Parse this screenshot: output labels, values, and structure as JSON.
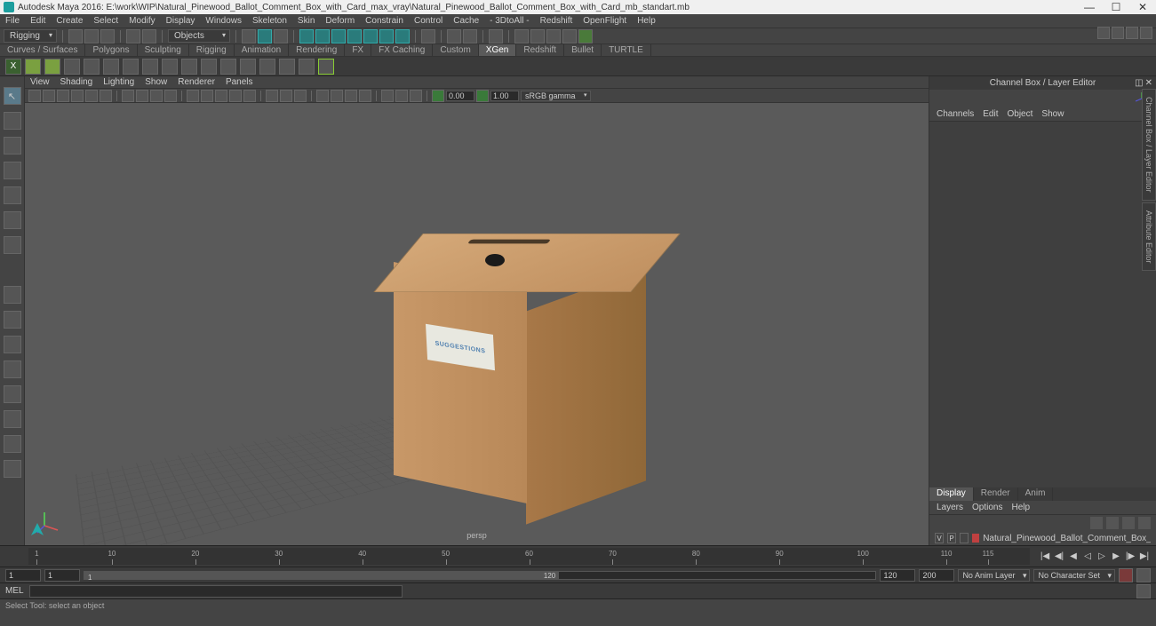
{
  "title": "Autodesk Maya 2016: E:\\work\\WIP\\Natural_Pinewood_Ballot_Comment_Box_with_Card_max_vray\\Natural_Pinewood_Ballot_Comment_Box_with_Card_mb_standart.mb",
  "menu": [
    "File",
    "Edit",
    "Create",
    "Select",
    "Modify",
    "Display",
    "Windows",
    "Skeleton",
    "Skin",
    "Deform",
    "Constrain",
    "Control",
    "Cache",
    "- 3DtoAll -",
    "Redshift",
    "OpenFlight",
    "Help"
  ],
  "workspace_dropdown": "Rigging",
  "mask_dropdown": "Objects",
  "shelf_tabs": [
    "Curves / Surfaces",
    "Polygons",
    "Sculpting",
    "Rigging",
    "Animation",
    "Rendering",
    "FX",
    "FX Caching",
    "Custom",
    "XGen",
    "Redshift",
    "Bullet",
    "TURTLE"
  ],
  "shelf_active": "XGen",
  "viewport_menu": [
    "View",
    "Shading",
    "Lighting",
    "Show",
    "Renderer",
    "Panels"
  ],
  "vp_exposure": "0.00",
  "vp_gamma": "1.00",
  "vp_colorspace": "sRGB gamma",
  "viewport_camera": "persp",
  "box_card_text": "SUGGESTIONS",
  "channel_panel_title": "Channel Box / Layer Editor",
  "channel_menu": [
    "Channels",
    "Edit",
    "Object",
    "Show"
  ],
  "layer_tabs": [
    "Display",
    "Render",
    "Anim"
  ],
  "layer_menu": [
    "Layers",
    "Options",
    "Help"
  ],
  "layer_item": {
    "v": "V",
    "p": "P",
    "name": "Natural_Pinewood_Ballot_Comment_Box_with_Card"
  },
  "side_tabs": [
    "Channel Box / Layer Editor",
    "Attribute Editor"
  ],
  "time_ticks": [
    1,
    10,
    20,
    30,
    40,
    50,
    60,
    70,
    80,
    90,
    100,
    110,
    115
  ],
  "range": {
    "start_outer": "1",
    "start_inner": "1",
    "end_inner": "120",
    "end_outer": "120",
    "end_total": "200",
    "anim_layer": "No Anim Layer",
    "char_set": "No Character Set"
  },
  "cmd_label": "MEL",
  "help_text": "Select Tool: select an object"
}
